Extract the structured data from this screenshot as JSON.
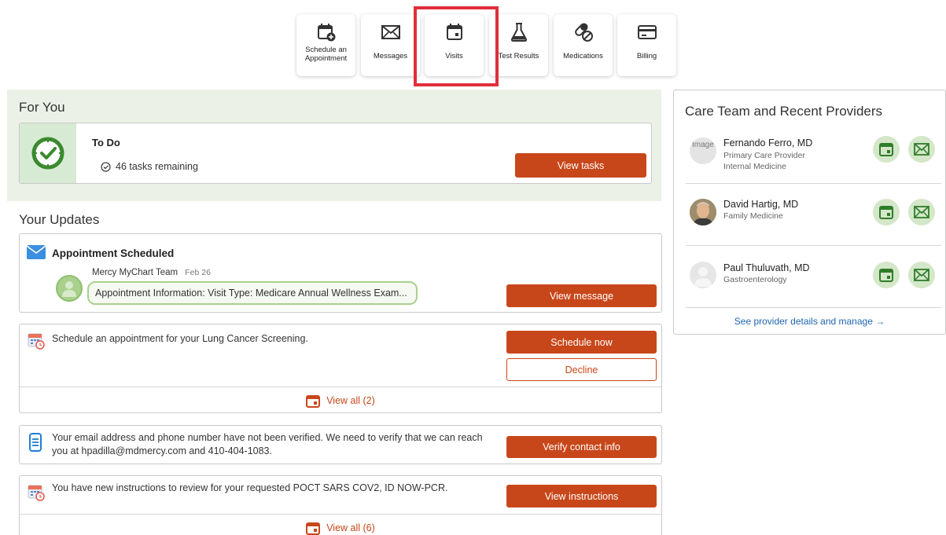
{
  "nav": {
    "items": [
      {
        "label": "Schedule an Appointment",
        "icon": "calendar-add-icon"
      },
      {
        "label": "Messages",
        "icon": "envelope-icon"
      },
      {
        "label": "Visits",
        "icon": "calendar-icon"
      },
      {
        "label": "Test Results",
        "icon": "flask-icon"
      },
      {
        "label": "Medications",
        "icon": "pills-icon"
      },
      {
        "label": "Billing",
        "icon": "credit-card-icon"
      }
    ]
  },
  "for_you": {
    "title": "For You",
    "todo": {
      "title": "To Do",
      "tasks": "46 tasks remaining",
      "button": "View tasks"
    }
  },
  "updates": {
    "title": "Your Updates",
    "appointment": {
      "title": "Appointment Scheduled",
      "sender": "Mercy MyChart Team",
      "date": "Feb 26",
      "preview": "Appointment Information: Visit Type: Medicare Annual Wellness Exam...",
      "button": "View message"
    },
    "lung": {
      "text": "Schedule an appointment for your Lung Cancer Screening.",
      "primary": "Schedule now",
      "secondary": "Decline",
      "view_all": "View all (2)"
    },
    "verify": {
      "text": "Your email address and phone number have not been verified. We need to verify that we can reach you at hpadilla@mdmercy.com and 410-404-1083.",
      "button": "Verify contact info"
    },
    "instructions": {
      "text": "You have new instructions to review for your requested POCT SARS COV2, ID NOW-PCR.",
      "button": "View instructions",
      "view_all": "View all (6)"
    }
  },
  "care_team": {
    "title": "Care Team and Recent Providers",
    "providers": [
      {
        "name": "Fernando Ferro, MD",
        "role": "Primary Care Provider",
        "specialty": "Internal Medicine",
        "avatar_alt": "Image"
      },
      {
        "name": "David Hartig, MD",
        "specialty": "Family Medicine"
      },
      {
        "name": "Paul Thuluvath, MD",
        "specialty": "Gastroenterology"
      }
    ],
    "see_all": "See provider details and manage →"
  },
  "colors": {
    "accent": "#c8471a",
    "highlight": "#e02f3a",
    "green_bg": "#ebf1e6",
    "green_icon": "#3a8a2e",
    "link": "#1f64b0"
  }
}
